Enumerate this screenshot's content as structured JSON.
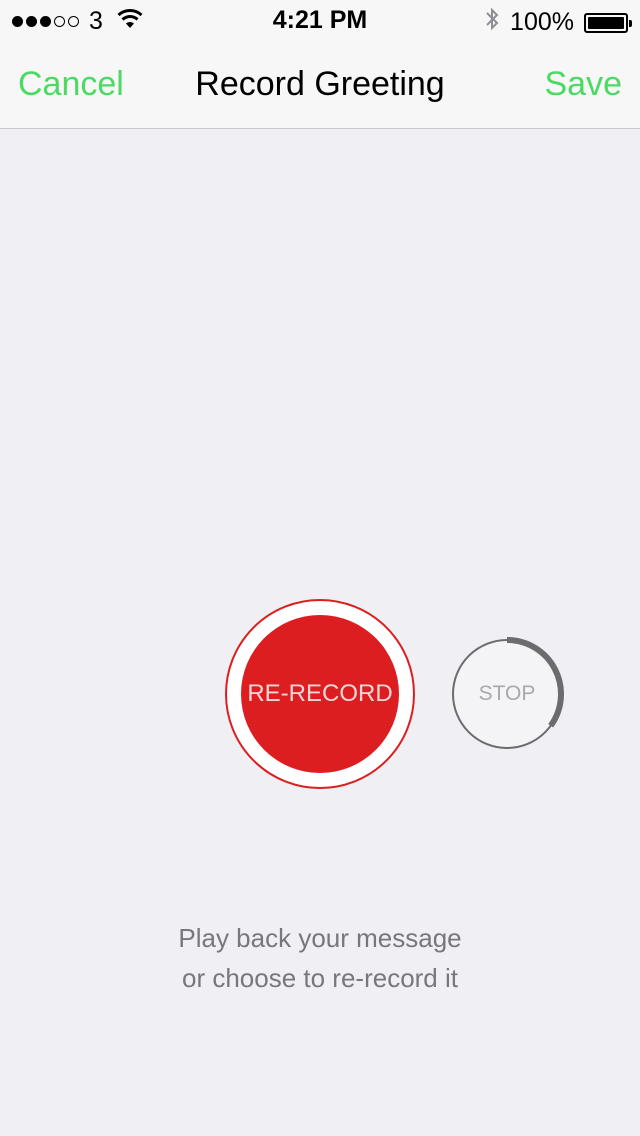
{
  "status_bar": {
    "signal_filled": 3,
    "signal_total": 5,
    "carrier": "3",
    "time": "4:21 PM",
    "bluetooth_icon": "bluetooth-icon",
    "battery_percent": "100%",
    "battery_level": 1.0
  },
  "nav": {
    "cancel_label": "Cancel",
    "title": "Record Greeting",
    "save_label": "Save",
    "accent_color": "#4cd964"
  },
  "recorder": {
    "record_label": "RE-RECORD",
    "record_color": "#dc1e21",
    "stop_label": "STOP",
    "stop_progress": 0.35
  },
  "hint": {
    "line1": "Play back your message",
    "line2": "or choose to re-record it"
  }
}
